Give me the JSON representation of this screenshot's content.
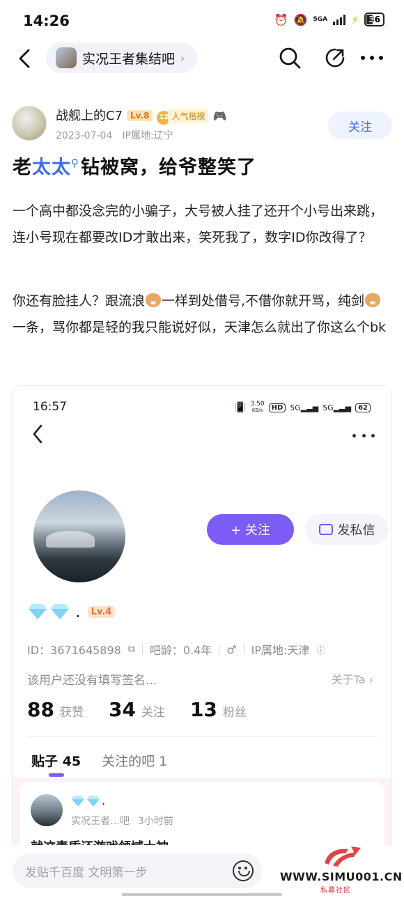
{
  "status_bar": {
    "time": "14:26",
    "network": "5GA",
    "battery": "36"
  },
  "nav": {
    "forum_name": "实况王者集结吧",
    "icons": [
      "back-arrow-icon",
      "search-icon",
      "share-icon",
      "more-icon"
    ]
  },
  "post": {
    "author_name": "战舰上的C7",
    "author_level": "Lv.8",
    "badge_number": "12",
    "badge_label": "人气楷模",
    "date": "2023-07-04",
    "ip_location": "IP属地:辽宁",
    "follow_label": "关注",
    "title_prefix": "老",
    "title_keyword": "太太",
    "title_suffix": "钻被窝，给爷整笑了",
    "paragraph1": "一个高中都没念完的小骗子，大号被人挂了还开个小号出来跳，连小号现在都要改ID才敢出来，笑死我了，数字ID你改得了？",
    "paragraph2_a": "你还有脸挂人？跟流浪",
    "paragraph2_b": "一样到处借号,不借你就开骂，纯剑",
    "paragraph2_c": "一条，骂你都是轻的我只能说好似，天津怎么就出了你这么个bk"
  },
  "screenshot": {
    "time": "16:57",
    "net_speed": "3.50",
    "net_unit": "KB/s",
    "battery": "62",
    "follow_button": "+ 关注",
    "dm_button": "发私信",
    "user_level": "Lv.4",
    "user_id": "ID：3671645898",
    "bar_age": "吧龄：0.4年",
    "ip": "IP属地:天津",
    "signature": "该用户还没有填写签名...",
    "about": "关于Ta",
    "stats": [
      {
        "value": "88",
        "label": "获赞"
      },
      {
        "value": "34",
        "label": "关注"
      },
      {
        "value": "13",
        "label": "粉丝"
      }
    ],
    "tab_posts": "贴子 45",
    "tab_forums": "关注的吧 1",
    "feed_forum": "实况王者…吧",
    "feed_time": "3小时前",
    "feed_title": "就这素质还游戏领域大神"
  },
  "bottom": {
    "comment_placeholder": "发贴千百度 文明第一步",
    "watermark_text": "WWW.SIMU001.CN",
    "watermark_sub": "私募社区"
  },
  "colors": {
    "accent_blue": "#3b6cf2",
    "purple": "#7c5cf5",
    "level_orange": "#d27a14"
  }
}
